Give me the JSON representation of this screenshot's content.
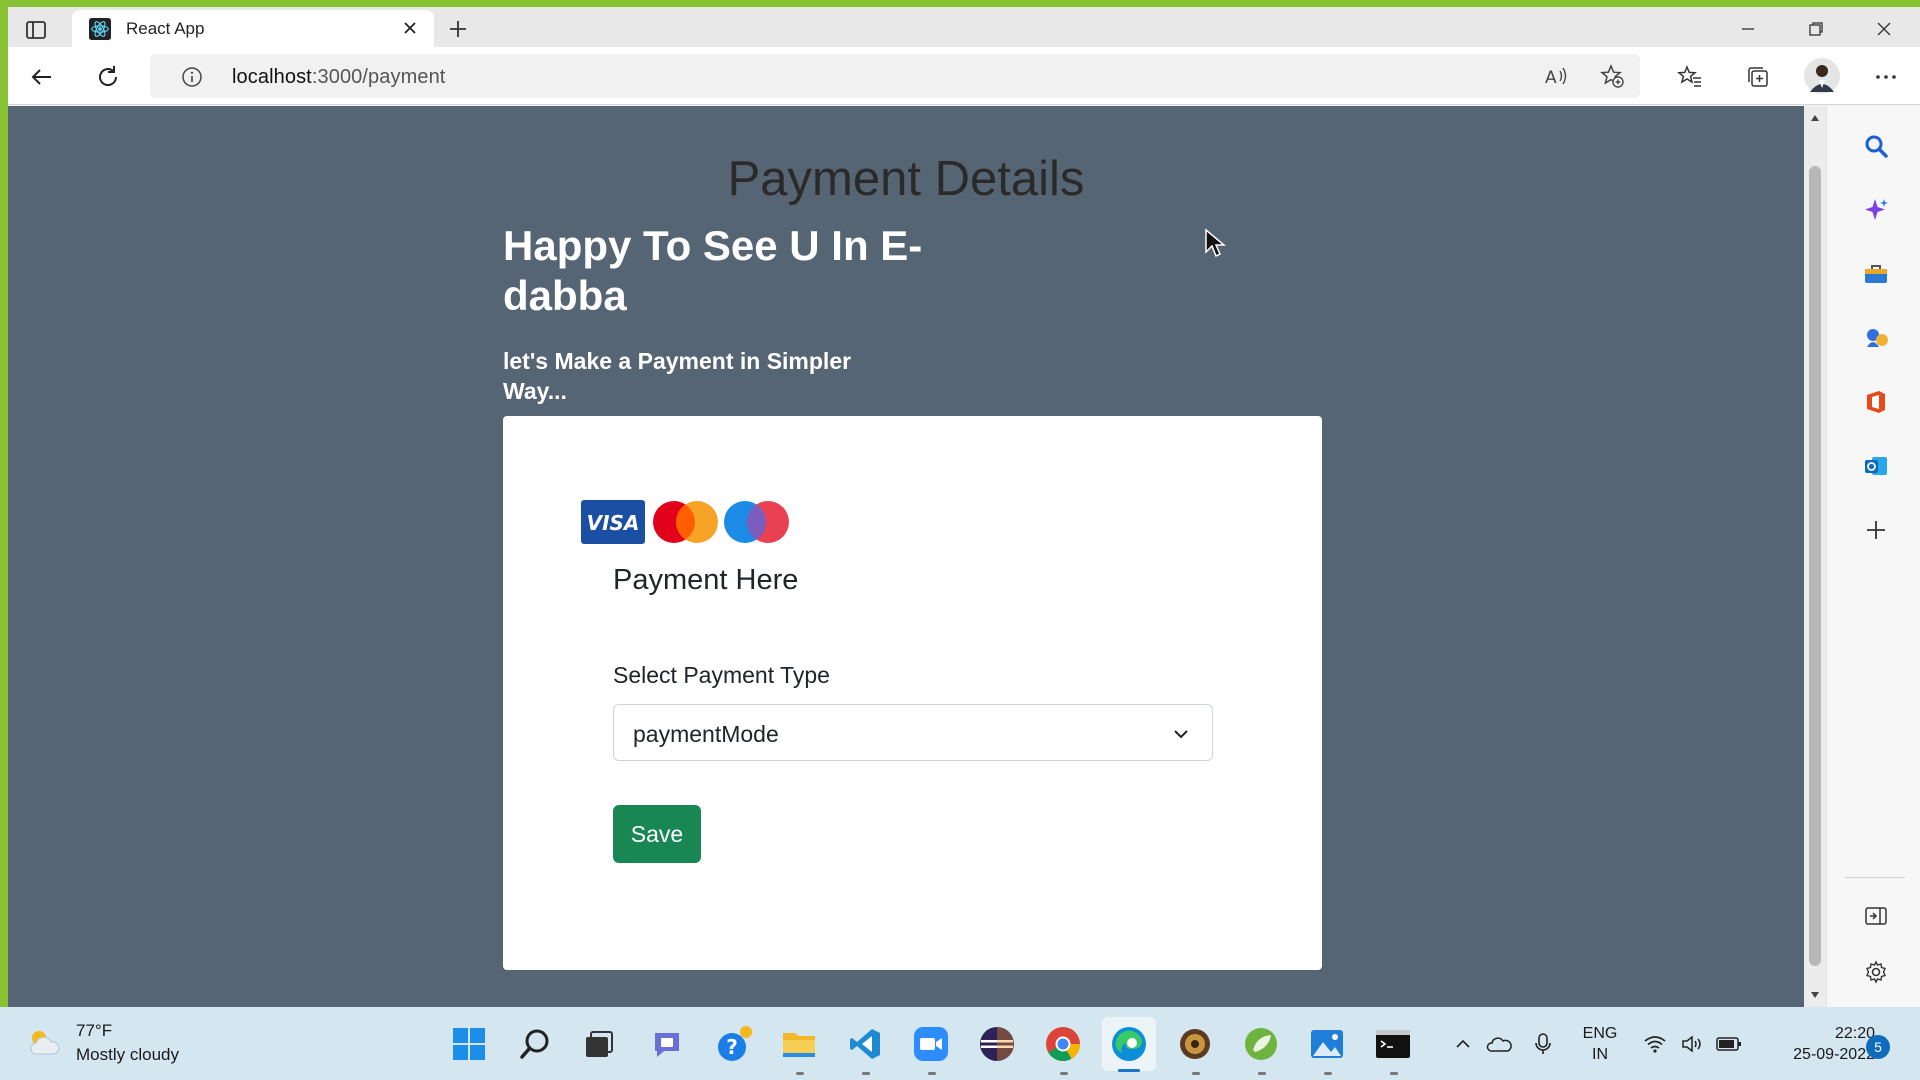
{
  "browser": {
    "tab_title": "React App",
    "url_host": "localhost",
    "url_path": ":3000/payment"
  },
  "page": {
    "title": "Payment Details",
    "welcome": "Happy To See U In E-dabba",
    "subtitle": "let's Make a Payment in Simpler Way...",
    "card": {
      "heading": "Payment Here",
      "select_label": "Select Payment Type",
      "select_value": "paymentMode",
      "save_label": "Save"
    }
  },
  "taskbar": {
    "weather_temp": "77°F",
    "weather_desc": "Mostly cloudy",
    "lang_line1": "ENG",
    "lang_line2": "IN",
    "time": "22:20",
    "date": "25-09-2022",
    "notification_count": "5"
  },
  "colors": {
    "page_bg": "#566574",
    "save_button": "#198754",
    "desktop_accent": "#86c232"
  }
}
